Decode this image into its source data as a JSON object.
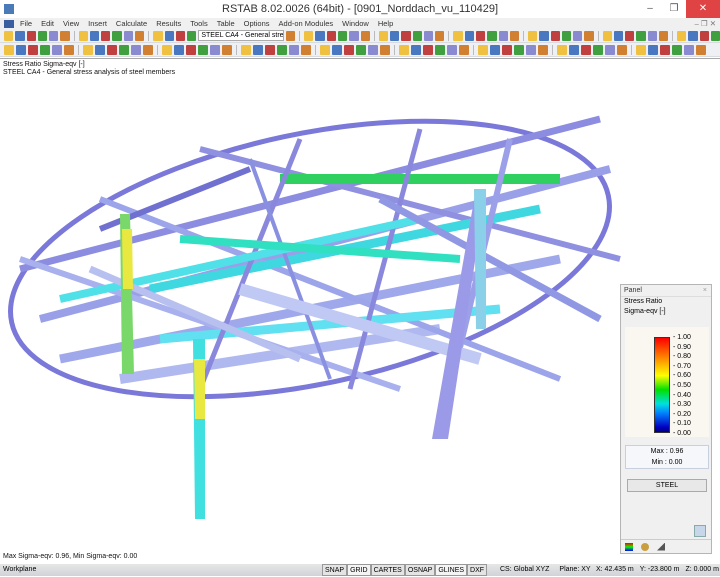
{
  "window": {
    "title": "RSTAB 8.02.0026 (64bit) - [0901_Norddach_vu_110429]",
    "minimize": "–",
    "maximize": "❐",
    "close": "✕"
  },
  "menu": [
    "File",
    "Edit",
    "View",
    "Insert",
    "Calculate",
    "Results",
    "Tools",
    "Table",
    "Options",
    "Add-on Modules",
    "Window",
    "Help"
  ],
  "menu_mdi": "– ❐ ✕",
  "toolbar": {
    "case_combo": "STEEL CA4 - General stre"
  },
  "viewport": {
    "title": "Stress Ratio Sigma-eqv [-]",
    "subtitle": "STEEL CA4 - General stress analysis of steel members",
    "footer": "Max Sigma-eqv: 0.96, Min Sigma-eqv: 0.00"
  },
  "panel": {
    "title": "Panel",
    "close": "×",
    "label1": "Stress Ratio",
    "label2": "Sigma-eqv [-]",
    "scale": [
      "1.00",
      "0.90",
      "0.80",
      "0.70",
      "0.60",
      "0.50",
      "0.40",
      "0.30",
      "0.20",
      "0.10",
      "0.00"
    ],
    "max_label": "Max",
    "max": "0.96",
    "min_label": "Min",
    "min": "0.00",
    "button": "STEEL"
  },
  "status": {
    "workplane": "Workplane",
    "toggles": [
      "SNAP",
      "GRID",
      "CARTES",
      "OSNAP",
      "GLINES",
      "DXF"
    ],
    "cs": "CS: Global XYZ",
    "plane": "Plane: XY",
    "x": "X: 42.435 m",
    "y": "Y: -23.800 m",
    "z": "Z: 0.000 m"
  }
}
